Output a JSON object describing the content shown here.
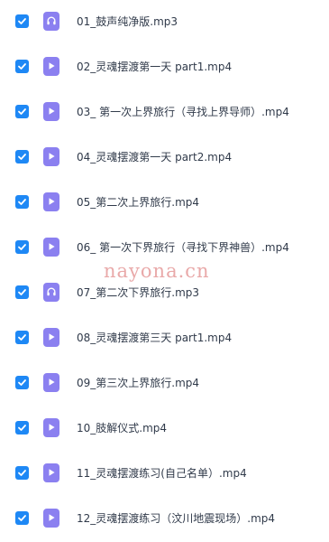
{
  "watermark": "nayona.cn",
  "files": [
    {
      "name": "01_鼓声纯净版.mp3",
      "icon": "audio-icon",
      "checked": true
    },
    {
      "name": "02_灵魂摆渡第一天 part1.mp4",
      "icon": "video-icon",
      "checked": true
    },
    {
      "name": "03_ 第一次上界旅行（寻找上界导师）.mp4",
      "icon": "video-icon",
      "checked": true
    },
    {
      "name": "04_灵魂摆渡第一天 part2.mp4",
      "icon": "video-icon",
      "checked": true
    },
    {
      "name": "05_第二次上界旅行.mp4",
      "icon": "video-icon",
      "checked": true
    },
    {
      "name": "06_ 第一次下界旅行（寻找下界神兽）.mp4",
      "icon": "video-icon",
      "checked": true
    },
    {
      "name": "07_第二次下界旅行.mp3",
      "icon": "audio-icon",
      "checked": true
    },
    {
      "name": "08_灵魂摆渡第三天 part1.mp4",
      "icon": "video-icon",
      "checked": true
    },
    {
      "name": "09_第三次上界旅行.mp4",
      "icon": "video-icon",
      "checked": true
    },
    {
      "name": "10_肢解仪式.mp4",
      "icon": "video-icon",
      "checked": true
    },
    {
      "name": "11_灵魂摆渡练习(自己名单）.mp4",
      "icon": "video-icon",
      "checked": true
    },
    {
      "name": "12_灵魂摆渡练习（汶川地震现场）.mp4",
      "icon": "video-icon",
      "checked": true
    }
  ],
  "colors": {
    "checkbox": "#1e88f5",
    "file_icon_bg": "#8b80f0",
    "text": "#303a4a",
    "watermark": "#e9a9a9"
  }
}
